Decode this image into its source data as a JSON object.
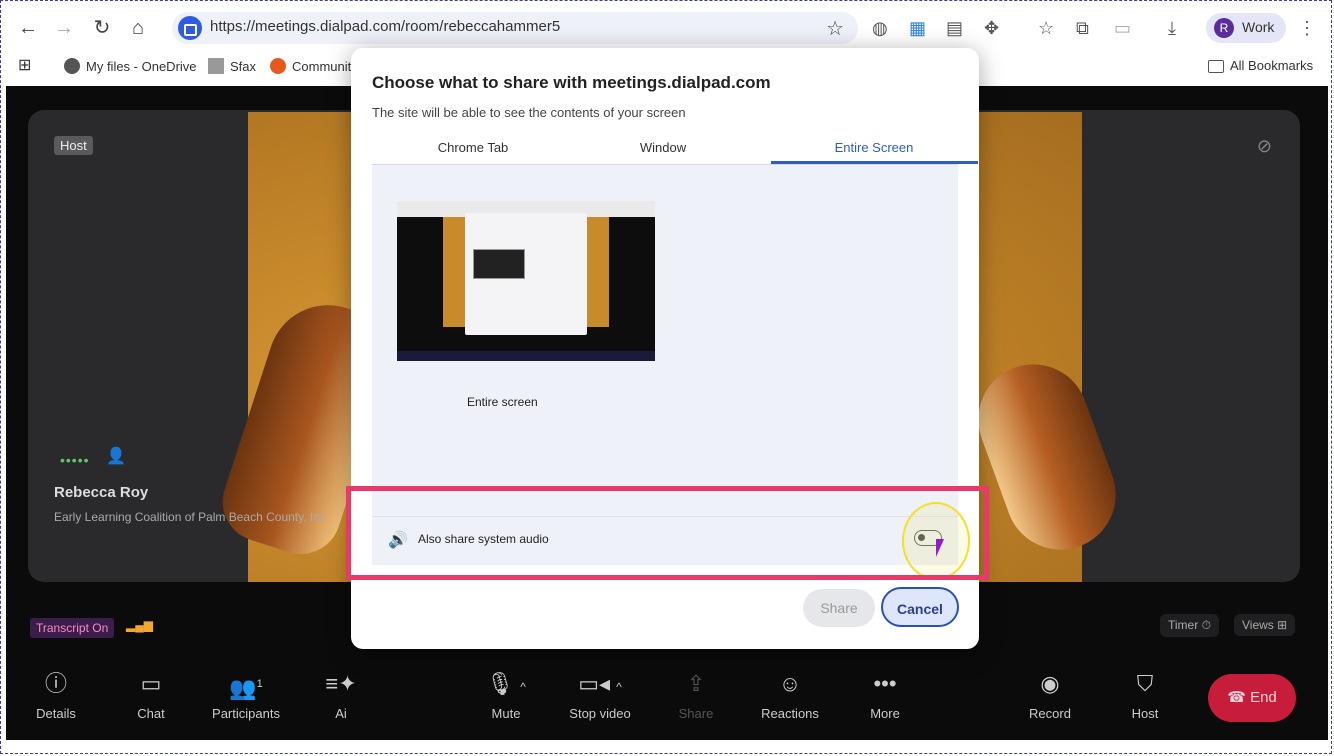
{
  "browser": {
    "url": "https://meetings.dialpad.com/room/rebeccahammer5",
    "profile_initial": "R",
    "profile_label": "Work",
    "bookmarks": [
      "My files - OneDrive",
      "Sfax",
      "Communit"
    ],
    "all_bookmarks": "All Bookmarks"
  },
  "meeting": {
    "host_badge": "Host",
    "participant_name": "Rebecca Roy",
    "participant_org": "Early Learning Coalition of Palm Beach County, Inc",
    "transcript": "Transcript On",
    "timer_label": "Timer",
    "views_label": "Views",
    "participants_count": "1",
    "controls": [
      {
        "label": "Details",
        "icon": "info-icon"
      },
      {
        "label": "Chat",
        "icon": "chat-icon"
      },
      {
        "label": "Participants",
        "icon": "participants-icon"
      },
      {
        "label": "Ai",
        "icon": "ai-icon"
      },
      {
        "label": "Mute",
        "icon": "mic-icon"
      },
      {
        "label": "Stop video",
        "icon": "video-icon"
      },
      {
        "label": "Share",
        "icon": "share-icon"
      },
      {
        "label": "Reactions",
        "icon": "smile-icon"
      },
      {
        "label": "More",
        "icon": "more-icon"
      },
      {
        "label": "Record",
        "icon": "record-icon"
      },
      {
        "label": "Host",
        "icon": "shield-icon"
      }
    ],
    "end_label": "End"
  },
  "dialog": {
    "title": "Choose what to share with meetings.dialpad.com",
    "subtitle": "The site will be able to see the contents of your screen",
    "tabs": [
      "Chrome Tab",
      "Window",
      "Entire Screen"
    ],
    "active_tab": "Entire Screen",
    "thumbnail_label": "Entire screen",
    "audio_label": "Also share system audio",
    "share_button": "Share",
    "cancel_button": "Cancel"
  }
}
